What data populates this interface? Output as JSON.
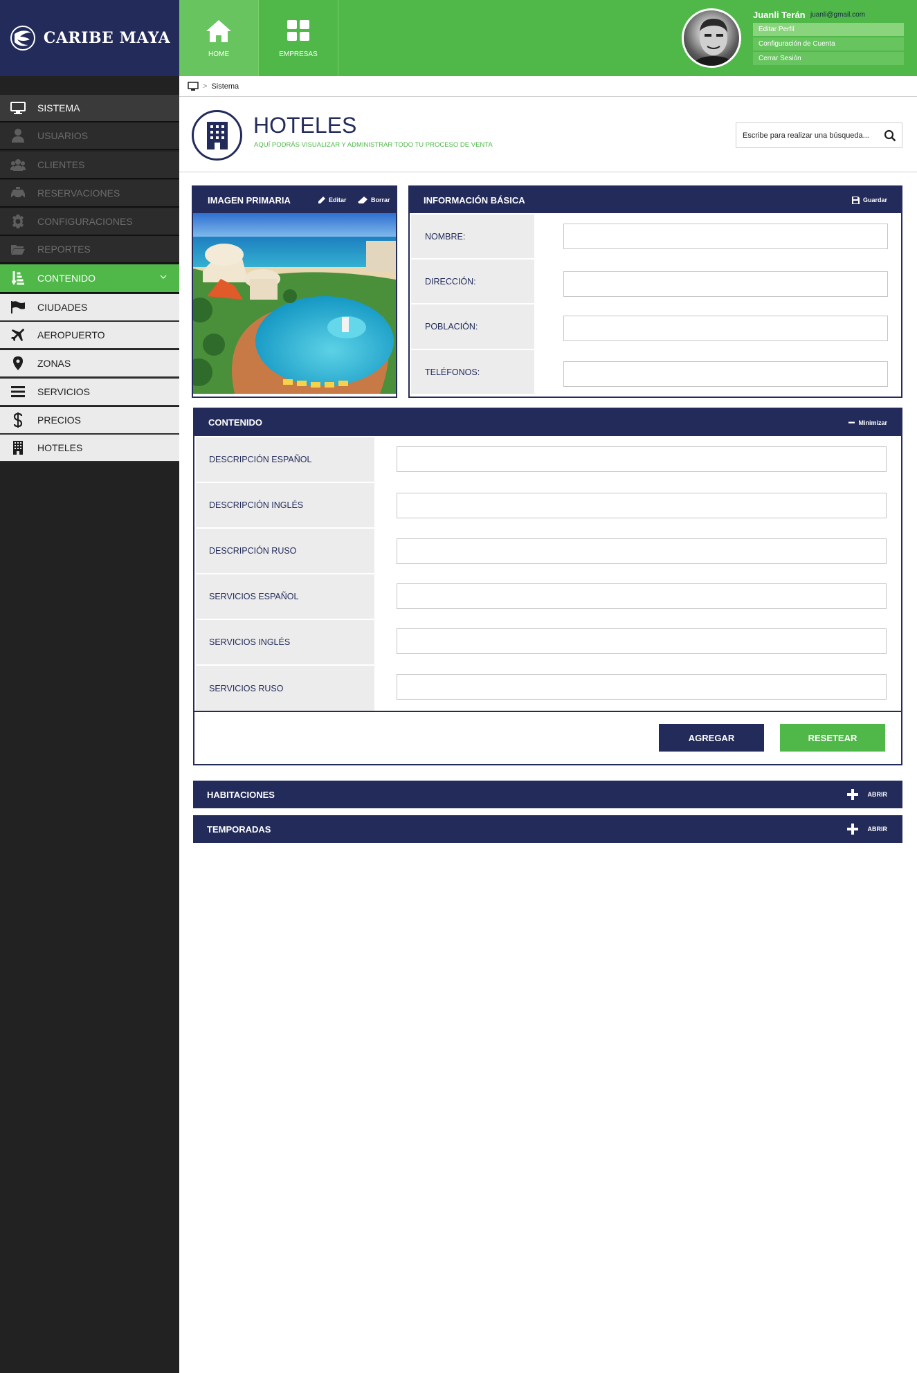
{
  "brand": {
    "name": "CARIBE MAYA",
    "colors": {
      "navy": "#232b5a",
      "green": "#4fb848",
      "sidebar": "#222222"
    }
  },
  "topnav": [
    {
      "label": "HOME",
      "icon": "home-icon",
      "active": true
    },
    {
      "label": "EMPRESAS",
      "icon": "grid-icon",
      "active": false
    }
  ],
  "user": {
    "name": "Juanli Terán",
    "email": "juanli@gmail.com",
    "menu": [
      "Editar Perfil",
      "Configuración de Cuenta",
      "Cerrar Sesión"
    ]
  },
  "sidebar": {
    "items": [
      {
        "label": "SISTEMA",
        "icon": "monitor-icon"
      },
      {
        "label": "USUARIOS",
        "icon": "user-icon"
      },
      {
        "label": "CLIENTES",
        "icon": "users-icon"
      },
      {
        "label": "RESERVACIONES",
        "icon": "taxi-icon"
      },
      {
        "label": "CONFIGURACIONES",
        "icon": "gear-icon"
      },
      {
        "label": "REPORTES",
        "icon": "folder-icon"
      },
      {
        "label": "CONTENIDO",
        "icon": "sort-icon"
      },
      {
        "label": "CIUDADES",
        "icon": "flag-icon"
      },
      {
        "label": "AEROPUERTO",
        "icon": "plane-icon"
      },
      {
        "label": "ZONAS",
        "icon": "map-pin-icon"
      },
      {
        "label": "SERVICIOS",
        "icon": "menu-icon"
      },
      {
        "label": "PRECIOS",
        "icon": "dollar-icon"
      },
      {
        "label": "HOTELES",
        "icon": "building-icon"
      }
    ]
  },
  "breadcrumb": {
    "label": "Sistema"
  },
  "page": {
    "title": "HOTELES",
    "subtitle": "AQUÍ PODRÁS VISUALIZAR Y ADMINISTRAR TODO TU PROCESO DE VENTA"
  },
  "search": {
    "placeholder": "Escribe para realizar una búsqueda..."
  },
  "image_panel": {
    "title": "IMAGEN PRIMARIA",
    "edit_label": "Editar",
    "delete_label": "Borrar"
  },
  "basic_info": {
    "title": "INFORMACIÓN BÁSICA",
    "save_label": "Guardar",
    "fields": [
      {
        "label": "NOMBRE:",
        "value": ""
      },
      {
        "label": "DIRECCIÓN:",
        "value": ""
      },
      {
        "label": "POBLACIÓN:",
        "value": ""
      },
      {
        "label": "TELÉFONOS:",
        "value": ""
      }
    ]
  },
  "content": {
    "title": "CONTENIDO",
    "minimize_label": "Minimizar",
    "fields": [
      {
        "label": "DESCRIPCIÓN ESPAÑOL",
        "value": ""
      },
      {
        "label": "DESCRIPCIÓN INGLÉS",
        "value": ""
      },
      {
        "label": "DESCRIPCIÓN RUSO",
        "value": ""
      },
      {
        "label": "SERVICIOS ESPAÑOL",
        "value": ""
      },
      {
        "label": "SERVICIOS INGLÉS",
        "value": ""
      },
      {
        "label": "SERVICIOS RUSO",
        "value": ""
      }
    ],
    "add_label": "AGREGAR",
    "reset_label": "RESETEAR"
  },
  "collapsed": [
    {
      "title": "HABITACIONES",
      "open_label": "Abrir"
    },
    {
      "title": "TEMPORADAS",
      "open_label": "Abrir"
    }
  ]
}
